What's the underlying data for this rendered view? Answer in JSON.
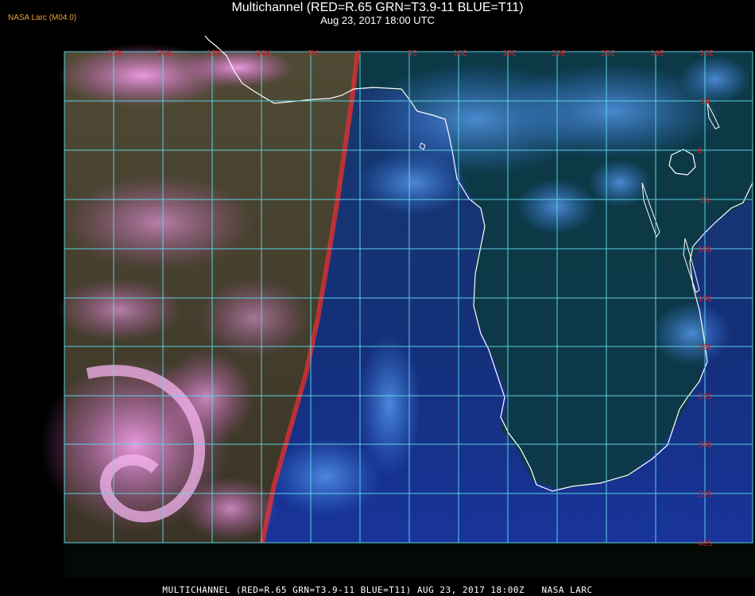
{
  "header": {
    "title": "Multichannel (RED=R.65 GRN=T3.9-11 BLUE=T11)",
    "subtitle": "Aug 23, 2017 18:00 UTC",
    "credit": "NASA Larc (M04.0)"
  },
  "footer": {
    "text": "MULTICHANNEL (RED=R.65 GRN=T3.9-11 BLUE=T11) AUG 23, 2017 18:00Z   NASA LARC"
  },
  "map": {
    "longitude_labels": [
      "25W",
      "20W",
      "15W",
      "10W",
      "5W",
      "0",
      "5E",
      "10E",
      "15E",
      "20E",
      "25E",
      "30E",
      "35E"
    ],
    "latitude_labels": [
      "5N",
      "0",
      "5S",
      "10S",
      "15S",
      "20S",
      "25S",
      "30S",
      "35S",
      "40S"
    ],
    "colors": {
      "grid": "#5fd8e8",
      "label": "#d02020",
      "coastline": "#ffffff",
      "reflective_clouds": "#d060c0",
      "land_day": "#5a4a32",
      "ocean_night": "#1a3a8a",
      "clouds_night": "#3c82e6",
      "terminator": "#e03030"
    }
  }
}
